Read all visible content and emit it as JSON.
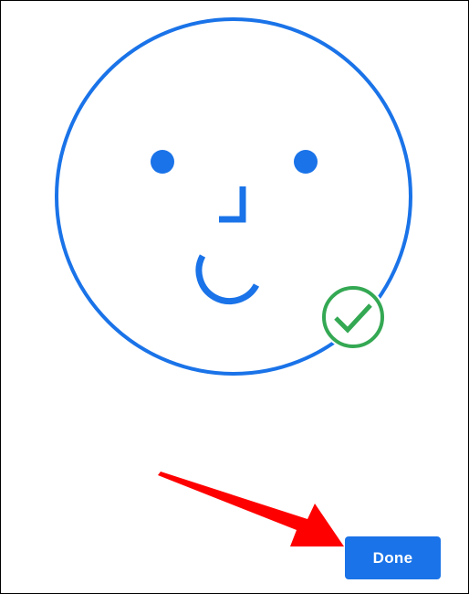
{
  "illustration": {
    "face_icon": "face-outline-icon",
    "check_icon": "check-circle-icon"
  },
  "actions": {
    "done_label": "Done"
  },
  "annotation": {
    "arrow_icon": "red-pointer-arrow-icon"
  },
  "colors": {
    "face_blue": "#1a73e8",
    "check_green": "#34a853",
    "button_blue": "#1a73e8",
    "arrow_red": "#ff0000"
  }
}
